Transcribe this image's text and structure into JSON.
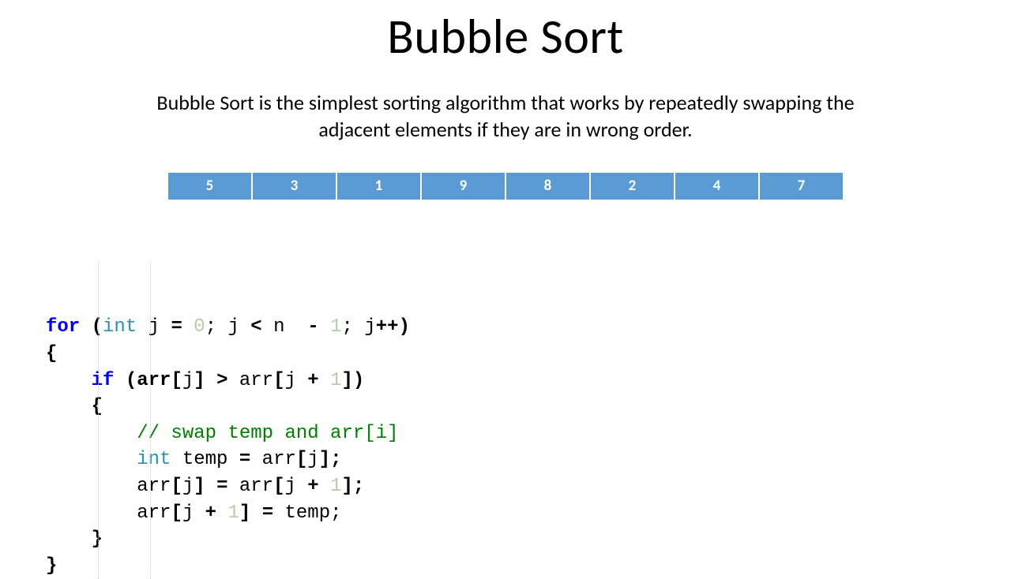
{
  "title": "Bubble Sort",
  "description": "Bubble Sort is the simplest sorting algorithm that works by repeatedly swapping the adjacent elements if they are in wrong order.",
  "array": [
    "5",
    "3",
    "1",
    "9",
    "8",
    "2",
    "4",
    "7"
  ],
  "code": {
    "for_kw": "for",
    "for_open": " (",
    "int_ty": "int",
    "j_decl": " j ",
    "eq1": "= ",
    "zero": "0",
    "semi1": "; j ",
    "lt": "<",
    "n_part": " n  ",
    "minus": "-",
    "space_one": " ",
    "one1": "1",
    "semi2": "; j",
    "plusplus": "++",
    "for_close": ")",
    "brace_open1": "{",
    "if_kw": "if",
    "if_open": " (arr",
    "lb1": "[",
    "j1": "j",
    "rb1": "] ",
    "gt": ">",
    "arr2": " arr",
    "lb2": "[",
    "j2": "j ",
    "plus1": "+",
    "sp_one2": " ",
    "one2": "1",
    "rb2": "])",
    "brace_open2": "{",
    "comment": "// swap temp and arr[i]",
    "int_ty2": "int",
    "temp_decl": " temp ",
    "eq2": "=",
    "arr3": " arr",
    "lb3": "[",
    "j3": "j",
    "rb3": "];",
    "arr4": "arr",
    "lb4": "[",
    "j4": "j",
    "rb4": "] ",
    "eq3": "=",
    "arr5": " arr",
    "lb5": "[",
    "j5": "j ",
    "plus2": "+",
    "sp_one3": " ",
    "one3": "1",
    "rb5": "];",
    "arr6": "arr",
    "lb6": "[",
    "j6": "j ",
    "plus3": "+",
    "sp_one4": " ",
    "one4": "1",
    "rb6": "] ",
    "eq4": "=",
    "temp2": " temp;",
    "brace_close2": "}",
    "brace_close1": "}"
  }
}
